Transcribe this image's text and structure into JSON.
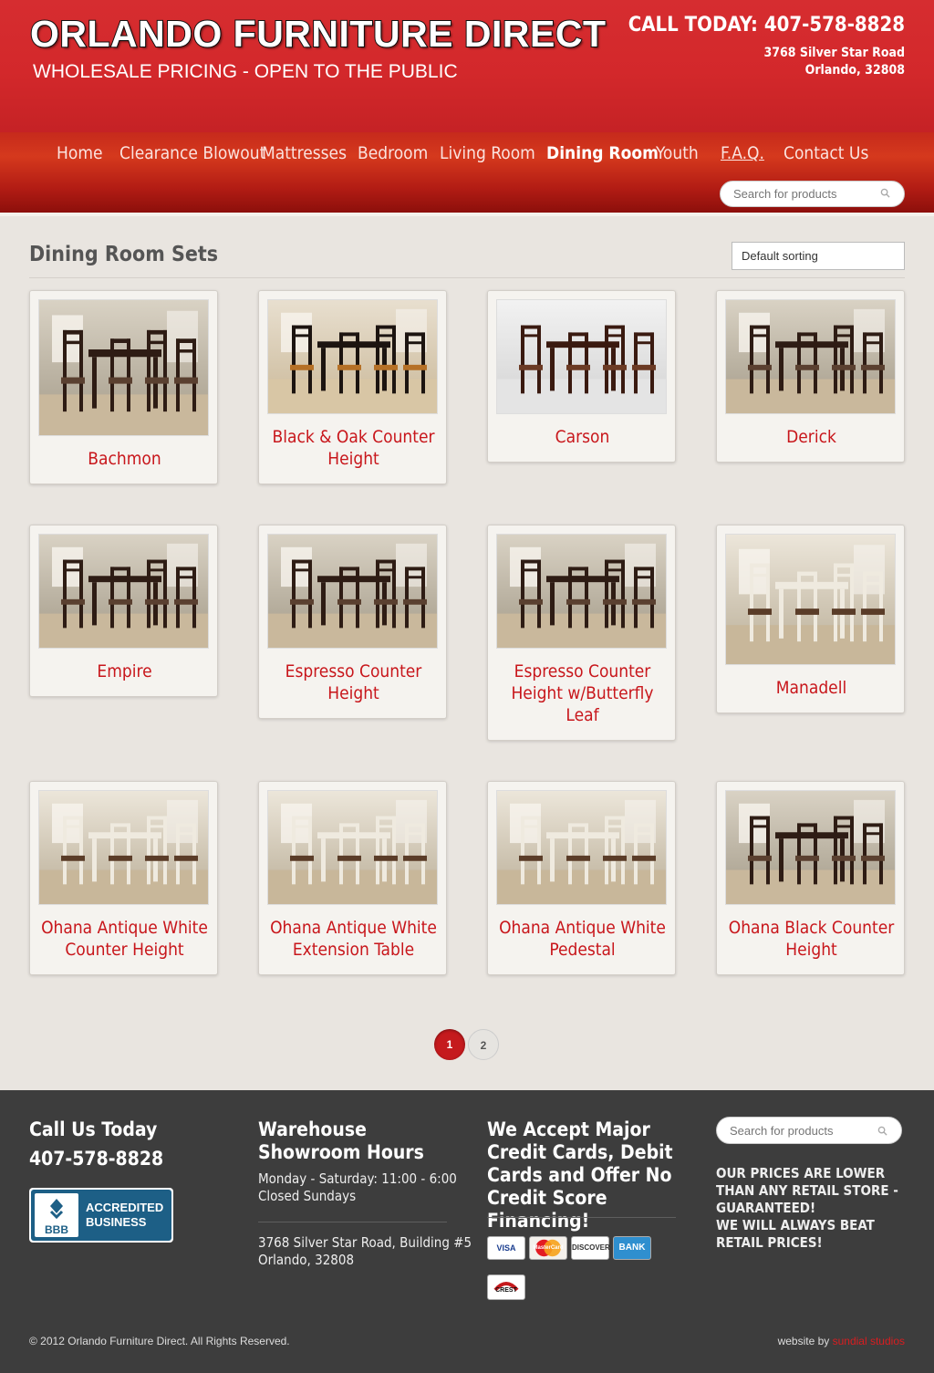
{
  "header": {
    "brand": "ORLANDO FURNITURE DIRECT",
    "tagline": "WHOLESALE PRICING - OPEN TO THE PUBLIC",
    "call": "CALL TODAY: 407-578-8828",
    "address_line1": "3768 Silver Star Road",
    "address_line2": "Orlando, 32808"
  },
  "nav": {
    "items": [
      {
        "label": "Home"
      },
      {
        "label": "Clearance Blowout"
      },
      {
        "label": "Mattresses"
      },
      {
        "label": "Bedroom"
      },
      {
        "label": "Living Room"
      },
      {
        "label": "Dining Room"
      },
      {
        "label": "Youth"
      },
      {
        "label": "F.A.Q."
      },
      {
        "label": "Contact Us"
      }
    ],
    "active": "Dining Room",
    "search_placeholder": "Search for products"
  },
  "page": {
    "title": "Dining Room Sets",
    "sort_value": "Default sorting"
  },
  "products": [
    {
      "name": "Bachmon",
      "style": "dark"
    },
    {
      "name": "Black & Oak Counter Height",
      "style": "oak"
    },
    {
      "name": "Carson",
      "style": "studio"
    },
    {
      "name": "Derick",
      "style": "dark"
    },
    {
      "name": "Empire",
      "style": "dark"
    },
    {
      "name": "Espresso Counter Height",
      "style": "dark"
    },
    {
      "name": "Espresso Counter Height w/Butterfly Leaf",
      "style": "dark"
    },
    {
      "name": "Manadell",
      "style": "white"
    },
    {
      "name": "Ohana Antique White Counter Height",
      "style": "white"
    },
    {
      "name": "Ohana Antique White Extension Table",
      "style": "white"
    },
    {
      "name": "Ohana Antique White Pedestal",
      "style": "white"
    },
    {
      "name": "Ohana Black Counter Height",
      "style": "dark"
    }
  ],
  "pagination": {
    "pages": [
      "1",
      "2"
    ],
    "current": "1"
  },
  "footer": {
    "call_heading": "Call Us Today",
    "call_phone": "407-578-8828",
    "bbb_line1": "ACCREDITED",
    "bbb_line2": "BUSINESS",
    "hours_heading": "Warehouse Showroom Hours",
    "hours_line1": "Monday - Saturday: 11:00 - 6:00",
    "hours_line2": "Closed Sundays",
    "address_line1": "3768 Silver Star Road, Building #5",
    "address_line2": "Orlando, 32808",
    "cards_heading": "We Accept Major Credit Cards, Debit Cards and Offer No Credit Score Financing!",
    "cards": [
      "VISA",
      "MasterCard",
      "DISCOVER",
      "BANK"
    ],
    "crest_label": "CREST",
    "search_placeholder": "Search for products",
    "promo1": "OUR PRICES ARE LOWER THAN ANY RETAIL STORE - GUARANTEED!",
    "promo2": "WE WILL ALWAYS BEAT RETAIL PRICES!",
    "copyright": "© 2012 Orlando Furniture Direct. All Rights Reserved.",
    "credit_prefix": "website by",
    "credit_link": "sundial studios"
  },
  "colors": {
    "brand_red": "#d3282b",
    "title_red": "#c8161b",
    "footer_bg": "#3d3d3d"
  }
}
